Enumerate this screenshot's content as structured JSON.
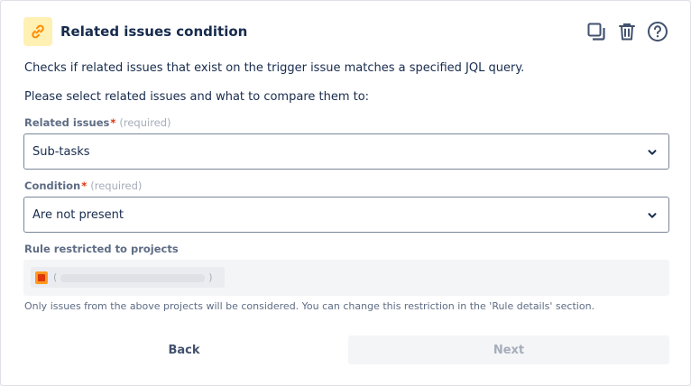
{
  "header": {
    "title": "Related issues condition",
    "icon": "link-icon",
    "icon_bg": "#fff0b3",
    "actions": [
      "copy-icon",
      "trash-icon",
      "help-icon"
    ]
  },
  "description": "Checks if related issues that exist on the trigger issue matches a specified JQL query.",
  "instruction": "Please select related issues and what to compare them to:",
  "related_issues": {
    "label": "Related issues",
    "required_star": "*",
    "required_hint": "(required)",
    "value": "Sub-tasks"
  },
  "condition": {
    "label": "Condition",
    "required_star": "*",
    "required_hint": "(required)",
    "value": "Are not present"
  },
  "projects": {
    "label": "Rule restricted to projects",
    "chip_open": "(",
    "chip_close": ")",
    "note": "Only issues from the above projects will be considered. You can change this restriction in the 'Rule details' section."
  },
  "buttons": {
    "back": "Back",
    "next": "Next"
  }
}
